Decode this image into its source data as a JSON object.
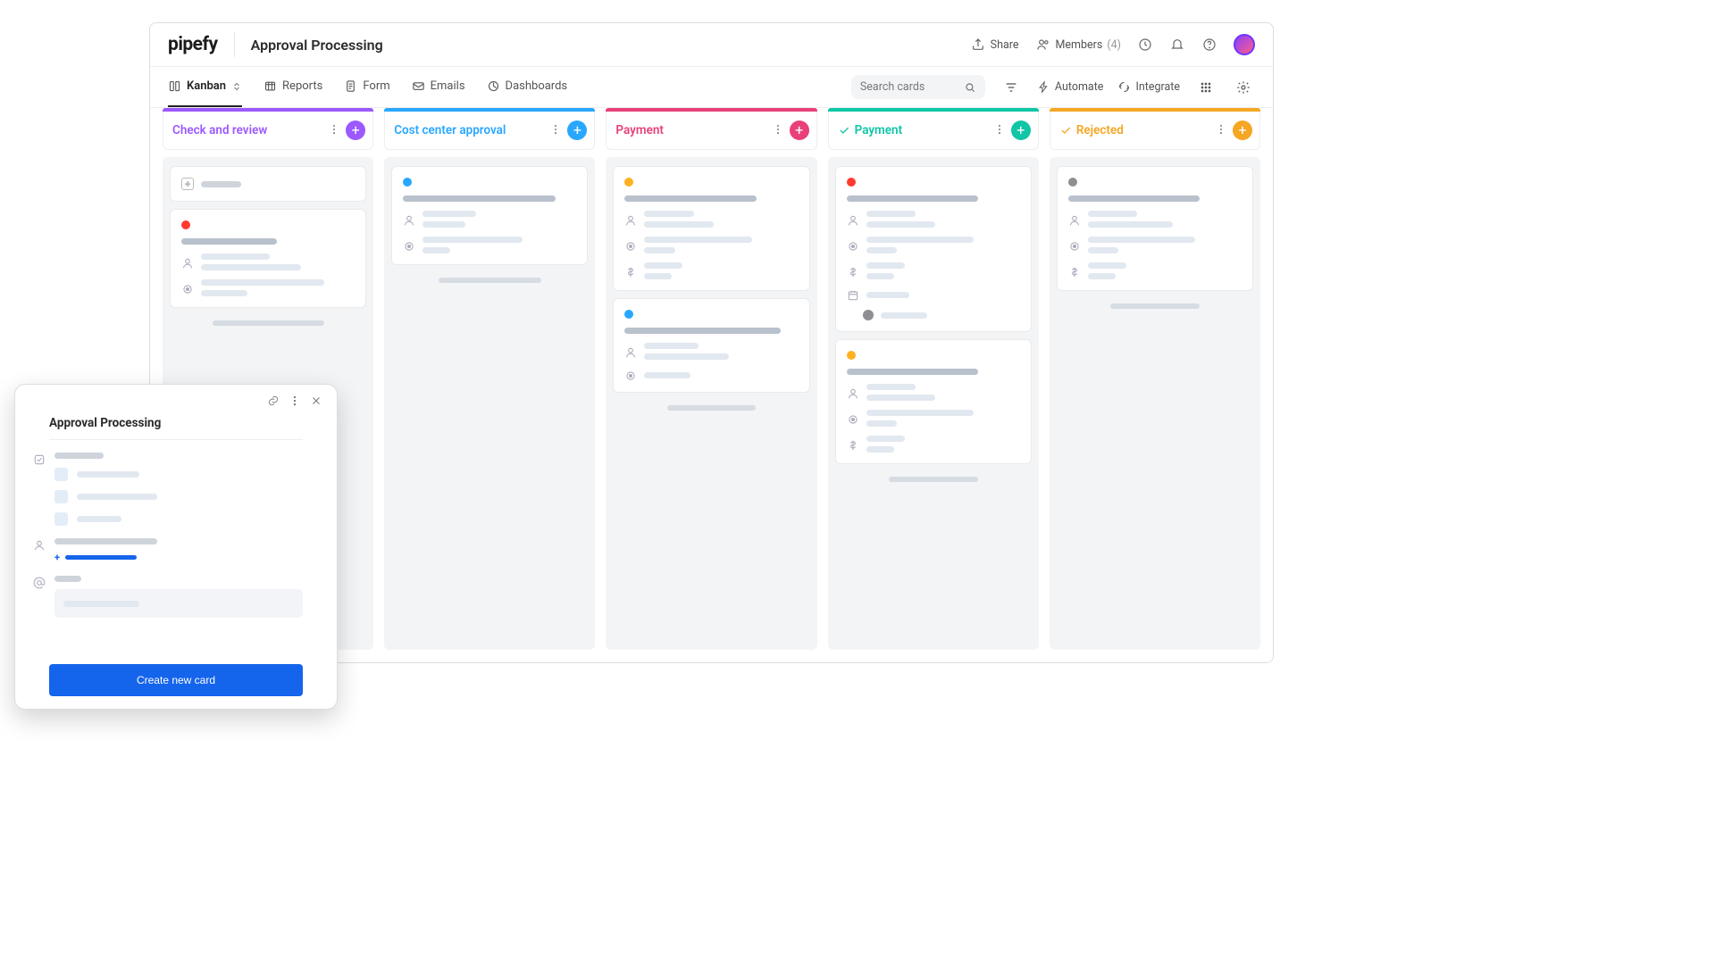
{
  "brand": "pipefy",
  "page_title": "Approval Processing",
  "header": {
    "share": "Share",
    "members": "Members",
    "members_count": "(4)"
  },
  "tabs": {
    "kanban": "Kanban",
    "reports": "Reports",
    "form": "Form",
    "emails": "Emails",
    "dashboards": "Dashboards"
  },
  "search": {
    "placeholder": "Search cards"
  },
  "actions": {
    "automate": "Automate",
    "integrate": "Integrate"
  },
  "columns": {
    "c1": {
      "title": "Check and review",
      "accent": "purple"
    },
    "c2": {
      "title": "Cost center approval",
      "accent": "blue"
    },
    "c3": {
      "title": "Payment",
      "accent": "pink",
      "prefix": ""
    },
    "c4": {
      "title": "Payment",
      "accent": "teal",
      "prefix": "check"
    },
    "c5": {
      "title": "Rejected",
      "accent": "orange",
      "prefix": "check"
    }
  },
  "modal": {
    "title": "Approval Processing",
    "cta": "Create new card",
    "add_link": ""
  }
}
